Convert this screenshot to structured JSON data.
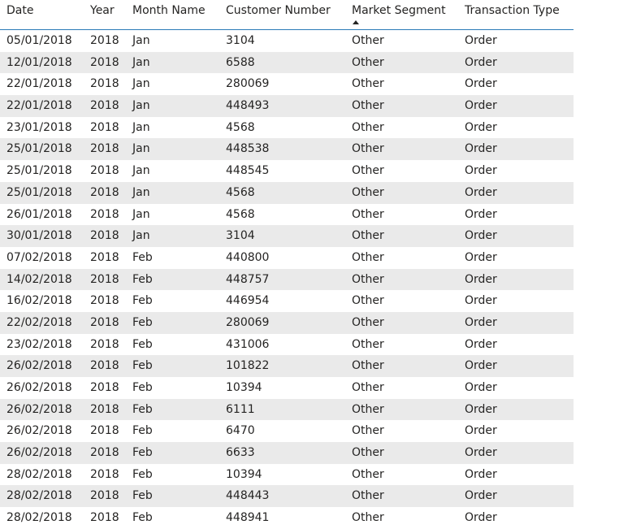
{
  "table": {
    "columns": [
      {
        "key": "date",
        "label": "Date"
      },
      {
        "key": "year",
        "label": "Year"
      },
      {
        "key": "month",
        "label": "Month Name"
      },
      {
        "key": "customer",
        "label": "Customer Number"
      },
      {
        "key": "segment",
        "label": "Market Segment",
        "sorted": "ascending"
      },
      {
        "key": "type",
        "label": "Transaction Type"
      }
    ],
    "rows": [
      [
        "05/01/2018",
        "2018",
        "Jan",
        "3104",
        "Other",
        "Order"
      ],
      [
        "12/01/2018",
        "2018",
        "Jan",
        "6588",
        "Other",
        "Order"
      ],
      [
        "22/01/2018",
        "2018",
        "Jan",
        "280069",
        "Other",
        "Order"
      ],
      [
        "22/01/2018",
        "2018",
        "Jan",
        "448493",
        "Other",
        "Order"
      ],
      [
        "23/01/2018",
        "2018",
        "Jan",
        "4568",
        "Other",
        "Order"
      ],
      [
        "25/01/2018",
        "2018",
        "Jan",
        "448538",
        "Other",
        "Order"
      ],
      [
        "25/01/2018",
        "2018",
        "Jan",
        "448545",
        "Other",
        "Order"
      ],
      [
        "25/01/2018",
        "2018",
        "Jan",
        "4568",
        "Other",
        "Order"
      ],
      [
        "26/01/2018",
        "2018",
        "Jan",
        "4568",
        "Other",
        "Order"
      ],
      [
        "30/01/2018",
        "2018",
        "Jan",
        "3104",
        "Other",
        "Order"
      ],
      [
        "07/02/2018",
        "2018",
        "Feb",
        "440800",
        "Other",
        "Order"
      ],
      [
        "14/02/2018",
        "2018",
        "Feb",
        "448757",
        "Other",
        "Order"
      ],
      [
        "16/02/2018",
        "2018",
        "Feb",
        "446954",
        "Other",
        "Order"
      ],
      [
        "22/02/2018",
        "2018",
        "Feb",
        "280069",
        "Other",
        "Order"
      ],
      [
        "23/02/2018",
        "2018",
        "Feb",
        "431006",
        "Other",
        "Order"
      ],
      [
        "26/02/2018",
        "2018",
        "Feb",
        "101822",
        "Other",
        "Order"
      ],
      [
        "26/02/2018",
        "2018",
        "Feb",
        "10394",
        "Other",
        "Order"
      ],
      [
        "26/02/2018",
        "2018",
        "Feb",
        "6111",
        "Other",
        "Order"
      ],
      [
        "26/02/2018",
        "2018",
        "Feb",
        "6470",
        "Other",
        "Order"
      ],
      [
        "26/02/2018",
        "2018",
        "Feb",
        "6633",
        "Other",
        "Order"
      ],
      [
        "28/02/2018",
        "2018",
        "Feb",
        "10394",
        "Other",
        "Order"
      ],
      [
        "28/02/2018",
        "2018",
        "Feb",
        "448443",
        "Other",
        "Order"
      ],
      [
        "28/02/2018",
        "2018",
        "Feb",
        "448941",
        "Other",
        "Order"
      ]
    ]
  }
}
